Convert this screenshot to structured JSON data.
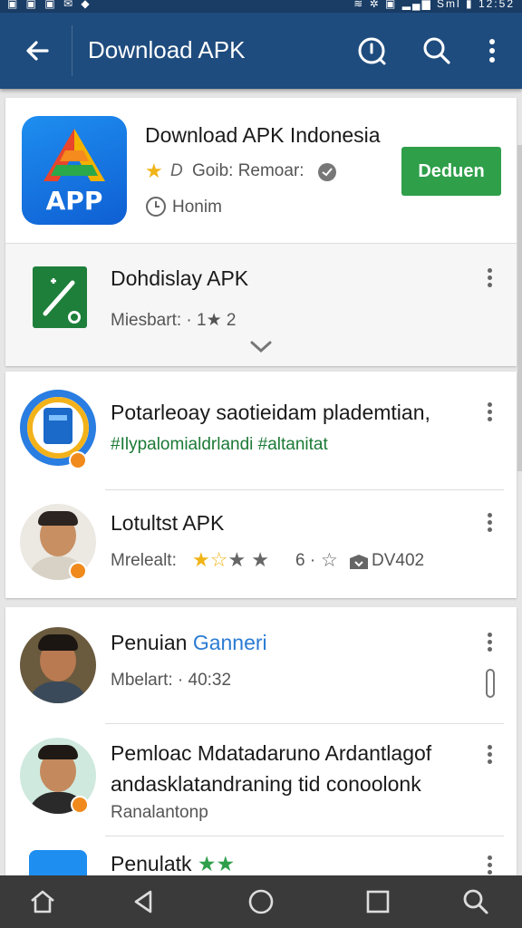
{
  "status_bar": {
    "left_icons": "▣ ▣ ▣ ✉ ◆",
    "right_text": "≋ ✲ ▣ ▂▄▆ Sml ▮ 12:52"
  },
  "app_bar": {
    "title": "Download APK"
  },
  "featured": {
    "icon_text": "APP",
    "title": "Download APK Indonesia",
    "rating_text": "Goib: Remoar:",
    "sub_text": "Honim",
    "install_label": "Deduen"
  },
  "sub_item": {
    "title": "Dohdislay APK",
    "meta": "Miesbart: · 1★ 2"
  },
  "list": [
    {
      "title": "Potarleoay saotieidam plademtian,",
      "hashtags": "#Ilypalomialdrlandi #altanitat"
    },
    {
      "title": "Lotultst APK",
      "meta_label": "Mrelealt:",
      "meta_num": "6 ·",
      "meta_tail": "DV402"
    },
    {
      "title_a": "Penuian",
      "title_b": "Ganneri",
      "meta": "Mbelart: · 40:32"
    },
    {
      "title_line1": "Pemloac Mdatadaruno Ardantlagof",
      "title_line2": "andasklatandraning tid conoolonk",
      "meta": "Ranalantonp"
    },
    {
      "title": "Penulatk"
    }
  ],
  "colors": {
    "app_bar": "#1f4c7e",
    "install": "#2f9f4a",
    "accent_blue": "#2b7bd3",
    "hashtag_green": "#1b7a36"
  }
}
